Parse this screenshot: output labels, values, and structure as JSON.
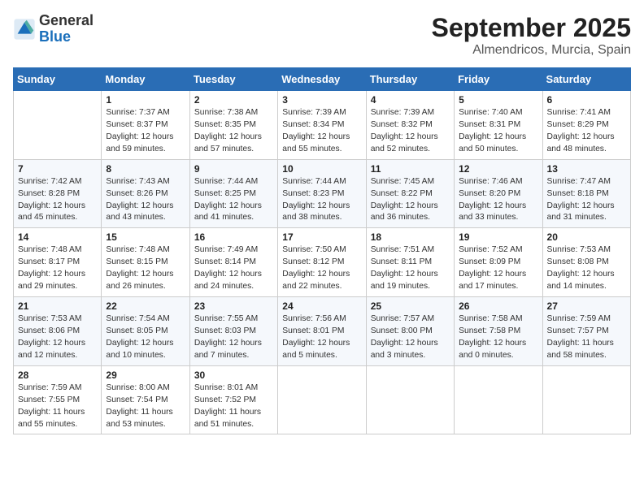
{
  "header": {
    "logo_general": "General",
    "logo_blue": "Blue",
    "month": "September 2025",
    "location": "Almendricos, Murcia, Spain"
  },
  "weekdays": [
    "Sunday",
    "Monday",
    "Tuesday",
    "Wednesday",
    "Thursday",
    "Friday",
    "Saturday"
  ],
  "weeks": [
    [
      {
        "day": "",
        "info": ""
      },
      {
        "day": "1",
        "info": "Sunrise: 7:37 AM\nSunset: 8:37 PM\nDaylight: 12 hours\nand 59 minutes."
      },
      {
        "day": "2",
        "info": "Sunrise: 7:38 AM\nSunset: 8:35 PM\nDaylight: 12 hours\nand 57 minutes."
      },
      {
        "day": "3",
        "info": "Sunrise: 7:39 AM\nSunset: 8:34 PM\nDaylight: 12 hours\nand 55 minutes."
      },
      {
        "day": "4",
        "info": "Sunrise: 7:39 AM\nSunset: 8:32 PM\nDaylight: 12 hours\nand 52 minutes."
      },
      {
        "day": "5",
        "info": "Sunrise: 7:40 AM\nSunset: 8:31 PM\nDaylight: 12 hours\nand 50 minutes."
      },
      {
        "day": "6",
        "info": "Sunrise: 7:41 AM\nSunset: 8:29 PM\nDaylight: 12 hours\nand 48 minutes."
      }
    ],
    [
      {
        "day": "7",
        "info": "Sunrise: 7:42 AM\nSunset: 8:28 PM\nDaylight: 12 hours\nand 45 minutes."
      },
      {
        "day": "8",
        "info": "Sunrise: 7:43 AM\nSunset: 8:26 PM\nDaylight: 12 hours\nand 43 minutes."
      },
      {
        "day": "9",
        "info": "Sunrise: 7:44 AM\nSunset: 8:25 PM\nDaylight: 12 hours\nand 41 minutes."
      },
      {
        "day": "10",
        "info": "Sunrise: 7:44 AM\nSunset: 8:23 PM\nDaylight: 12 hours\nand 38 minutes."
      },
      {
        "day": "11",
        "info": "Sunrise: 7:45 AM\nSunset: 8:22 PM\nDaylight: 12 hours\nand 36 minutes."
      },
      {
        "day": "12",
        "info": "Sunrise: 7:46 AM\nSunset: 8:20 PM\nDaylight: 12 hours\nand 33 minutes."
      },
      {
        "day": "13",
        "info": "Sunrise: 7:47 AM\nSunset: 8:18 PM\nDaylight: 12 hours\nand 31 minutes."
      }
    ],
    [
      {
        "day": "14",
        "info": "Sunrise: 7:48 AM\nSunset: 8:17 PM\nDaylight: 12 hours\nand 29 minutes."
      },
      {
        "day": "15",
        "info": "Sunrise: 7:48 AM\nSunset: 8:15 PM\nDaylight: 12 hours\nand 26 minutes."
      },
      {
        "day": "16",
        "info": "Sunrise: 7:49 AM\nSunset: 8:14 PM\nDaylight: 12 hours\nand 24 minutes."
      },
      {
        "day": "17",
        "info": "Sunrise: 7:50 AM\nSunset: 8:12 PM\nDaylight: 12 hours\nand 22 minutes."
      },
      {
        "day": "18",
        "info": "Sunrise: 7:51 AM\nSunset: 8:11 PM\nDaylight: 12 hours\nand 19 minutes."
      },
      {
        "day": "19",
        "info": "Sunrise: 7:52 AM\nSunset: 8:09 PM\nDaylight: 12 hours\nand 17 minutes."
      },
      {
        "day": "20",
        "info": "Sunrise: 7:53 AM\nSunset: 8:08 PM\nDaylight: 12 hours\nand 14 minutes."
      }
    ],
    [
      {
        "day": "21",
        "info": "Sunrise: 7:53 AM\nSunset: 8:06 PM\nDaylight: 12 hours\nand 12 minutes."
      },
      {
        "day": "22",
        "info": "Sunrise: 7:54 AM\nSunset: 8:05 PM\nDaylight: 12 hours\nand 10 minutes."
      },
      {
        "day": "23",
        "info": "Sunrise: 7:55 AM\nSunset: 8:03 PM\nDaylight: 12 hours\nand 7 minutes."
      },
      {
        "day": "24",
        "info": "Sunrise: 7:56 AM\nSunset: 8:01 PM\nDaylight: 12 hours\nand 5 minutes."
      },
      {
        "day": "25",
        "info": "Sunrise: 7:57 AM\nSunset: 8:00 PM\nDaylight: 12 hours\nand 3 minutes."
      },
      {
        "day": "26",
        "info": "Sunrise: 7:58 AM\nSunset: 7:58 PM\nDaylight: 12 hours\nand 0 minutes."
      },
      {
        "day": "27",
        "info": "Sunrise: 7:59 AM\nSunset: 7:57 PM\nDaylight: 11 hours\nand 58 minutes."
      }
    ],
    [
      {
        "day": "28",
        "info": "Sunrise: 7:59 AM\nSunset: 7:55 PM\nDaylight: 11 hours\nand 55 minutes."
      },
      {
        "day": "29",
        "info": "Sunrise: 8:00 AM\nSunset: 7:54 PM\nDaylight: 11 hours\nand 53 minutes."
      },
      {
        "day": "30",
        "info": "Sunrise: 8:01 AM\nSunset: 7:52 PM\nDaylight: 11 hours\nand 51 minutes."
      },
      {
        "day": "",
        "info": ""
      },
      {
        "day": "",
        "info": ""
      },
      {
        "day": "",
        "info": ""
      },
      {
        "day": "",
        "info": ""
      }
    ]
  ]
}
